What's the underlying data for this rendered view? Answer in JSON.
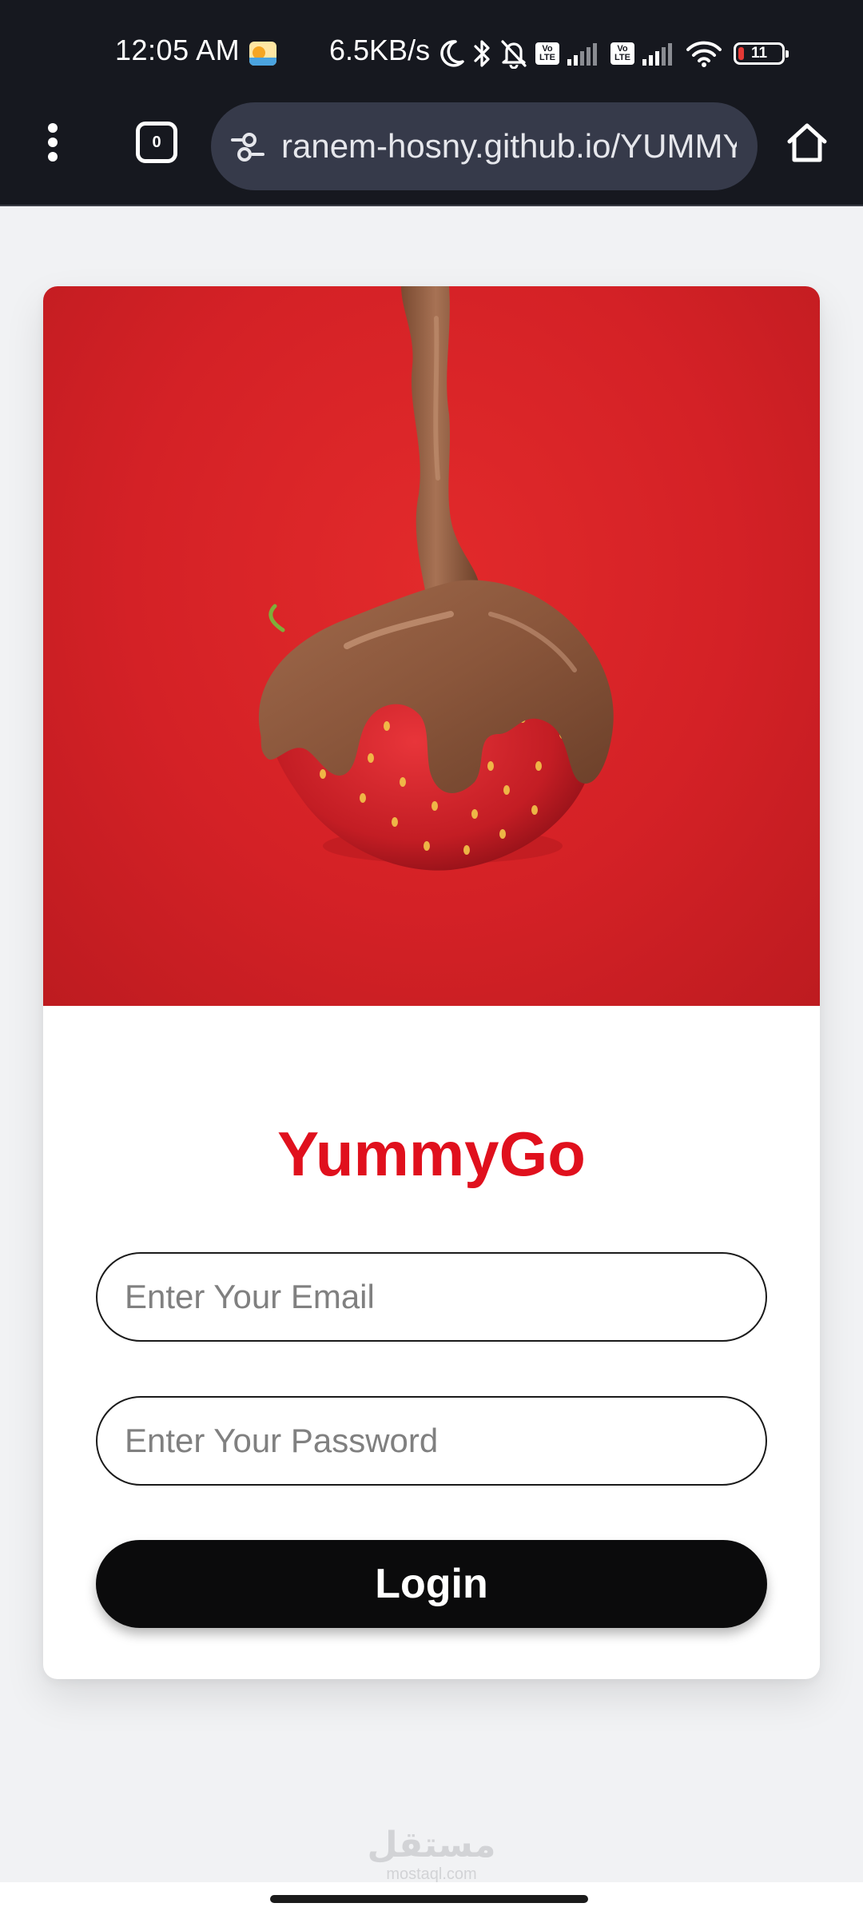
{
  "status_bar": {
    "time": "12:05 AM",
    "network_speed": "6.5KB/s",
    "volte_1": "Vo LTE",
    "volte_2": "Vo LTE",
    "battery_level": "11",
    "icons": [
      "app-notification-icon",
      "do-not-disturb-moon-icon",
      "bluetooth-icon",
      "notifications-off-icon",
      "volte-icon",
      "signal-icon",
      "volte-icon",
      "signal-icon",
      "wifi-icon",
      "battery-icon"
    ]
  },
  "browser": {
    "url": "ranem-hosny.github.io/YUMMYGO",
    "tab_count": "0",
    "icons": [
      "more-vert-icon",
      "tab-switcher-icon",
      "site-settings-icon",
      "home-icon"
    ]
  },
  "login": {
    "hero_image_alt": "chocolate-dipped-strawberry",
    "title": "YummyGo",
    "email_placeholder": "Enter Your Email",
    "password_placeholder": "Enter Your Password",
    "login_label": "Login"
  },
  "watermark": {
    "arabic": "مستقل",
    "latin": "mostaql.com"
  },
  "colors": {
    "brand": "#e0101d",
    "hero_background": "#d42126",
    "button": "#0b0b0c",
    "system_bar": "#16181f",
    "url_bar": "#363a4a",
    "page_background": "#f1f2f4"
  }
}
